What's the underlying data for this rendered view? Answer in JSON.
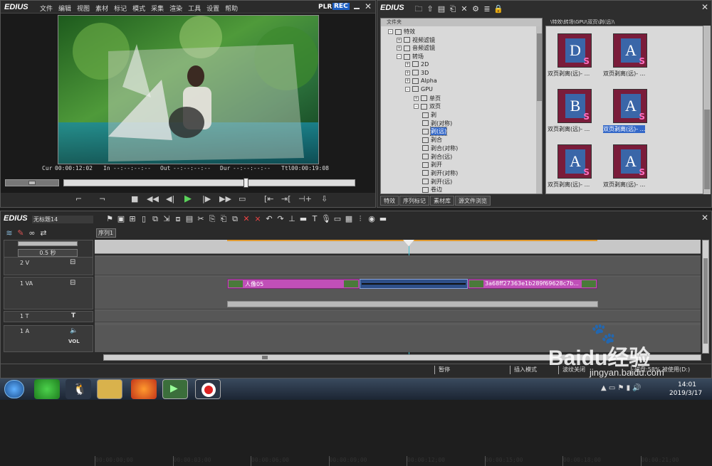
{
  "player": {
    "brand": "EDIUS",
    "menu": [
      "文件",
      "编辑",
      "视图",
      "素材",
      "标记",
      "模式",
      "采集",
      "渲染",
      "工具",
      "设置",
      "帮助"
    ],
    "plr": "PLR",
    "rec": "REC",
    "timecodes": {
      "cur_label": "Cur",
      "cur": "00:00:12:02",
      "in_label": "In",
      "in": "--:--:--:--",
      "out_label": "Out",
      "out": "--:--:--:--",
      "dur_label": "Dur",
      "dur": "--:--:--:--",
      "ttl_label": "Ttl",
      "ttl": "00:00:19:08"
    }
  },
  "bin": {
    "brand": "EDIUS",
    "tree_header": "文件夹",
    "tree": [
      {
        "label": "特效",
        "toggle": "-",
        "indent": 0
      },
      {
        "label": "视频滤镜",
        "toggle": "+",
        "indent": 1
      },
      {
        "label": "音频滤镜",
        "toggle": "+",
        "indent": 1
      },
      {
        "label": "转场",
        "toggle": "-",
        "indent": 1
      },
      {
        "label": "2D",
        "toggle": "+",
        "indent": 2
      },
      {
        "label": "3D",
        "toggle": "+",
        "indent": 2
      },
      {
        "label": "Alpha",
        "toggle": "+",
        "indent": 2
      },
      {
        "label": "GPU",
        "toggle": "-",
        "indent": 2
      },
      {
        "label": "单页",
        "toggle": "+",
        "indent": 3
      },
      {
        "label": "双页",
        "toggle": "-",
        "indent": 3
      },
      {
        "label": "剥",
        "toggle": "",
        "indent": 4
      },
      {
        "label": "剥(对称)",
        "toggle": "",
        "indent": 4
      },
      {
        "label": "剥(远)",
        "toggle": "",
        "indent": 4,
        "selected": true
      },
      {
        "label": "剥合",
        "toggle": "",
        "indent": 4
      },
      {
        "label": "剥合(对称)",
        "toggle": "",
        "indent": 4
      },
      {
        "label": "剥合(远)",
        "toggle": "",
        "indent": 4
      },
      {
        "label": "剥开",
        "toggle": "",
        "indent": 4
      },
      {
        "label": "剥开(对称)",
        "toggle": "",
        "indent": 4
      },
      {
        "label": "剥开(远)",
        "toggle": "",
        "indent": 4
      },
      {
        "label": "卷边",
        "toggle": "",
        "indent": 4
      }
    ],
    "path": "\\特效\\转场\\GPU\\双页\\剥(远)\\",
    "thumbs": [
      {
        "letter": "D",
        "caption": "双页剥离(远)- ..."
      },
      {
        "letter": "A",
        "caption": "双页剥离(远)- ..."
      },
      {
        "letter": "B",
        "caption": "双页剥离(远)- ..."
      },
      {
        "letter": "A",
        "caption": "双页剥离(远)- ...",
        "selected": true
      },
      {
        "letter": "A",
        "caption": "双页剥离(远)- ..."
      },
      {
        "letter": "A",
        "caption": "双页剥离(远)- ..."
      }
    ],
    "tabs": [
      "特效",
      "序列标记",
      "素材库",
      "源文件浏览"
    ]
  },
  "timeline": {
    "brand": "EDIUS",
    "project": "无标题14",
    "sequence_tab": "序列1",
    "scale": "0.5 秒",
    "ruler": [
      "00:00:00;00",
      "00:00:03;00",
      "00:00:06;00",
      "00:00:09;00",
      "00:00:12;00",
      "00:00:15;00",
      "00:00:18;00",
      "00:00:21;00"
    ],
    "tracks": {
      "v2": "2 V",
      "va1": "1 VA",
      "t1": "1 T",
      "a1": "1 A",
      "vol": "VOL"
    },
    "clips": {
      "clip1": "人像05",
      "clip2": "3a68ff27363e1b289f69628c7b..."
    }
  },
  "statusbar": {
    "pause": "暂停",
    "mode": "插入模式",
    "ripple": "波纹关闭",
    "disk": "磁盘:58% 被使用(D:)"
  },
  "taskbar": {
    "time": "14:01",
    "date": "2019/3/17"
  },
  "watermark": {
    "text": "Baidu经验",
    "url": "jingyan.baidu.com"
  },
  "colors": {
    "accent": "#32a6ff",
    "clip": "#c04fb8",
    "selection": "#3468c8"
  }
}
